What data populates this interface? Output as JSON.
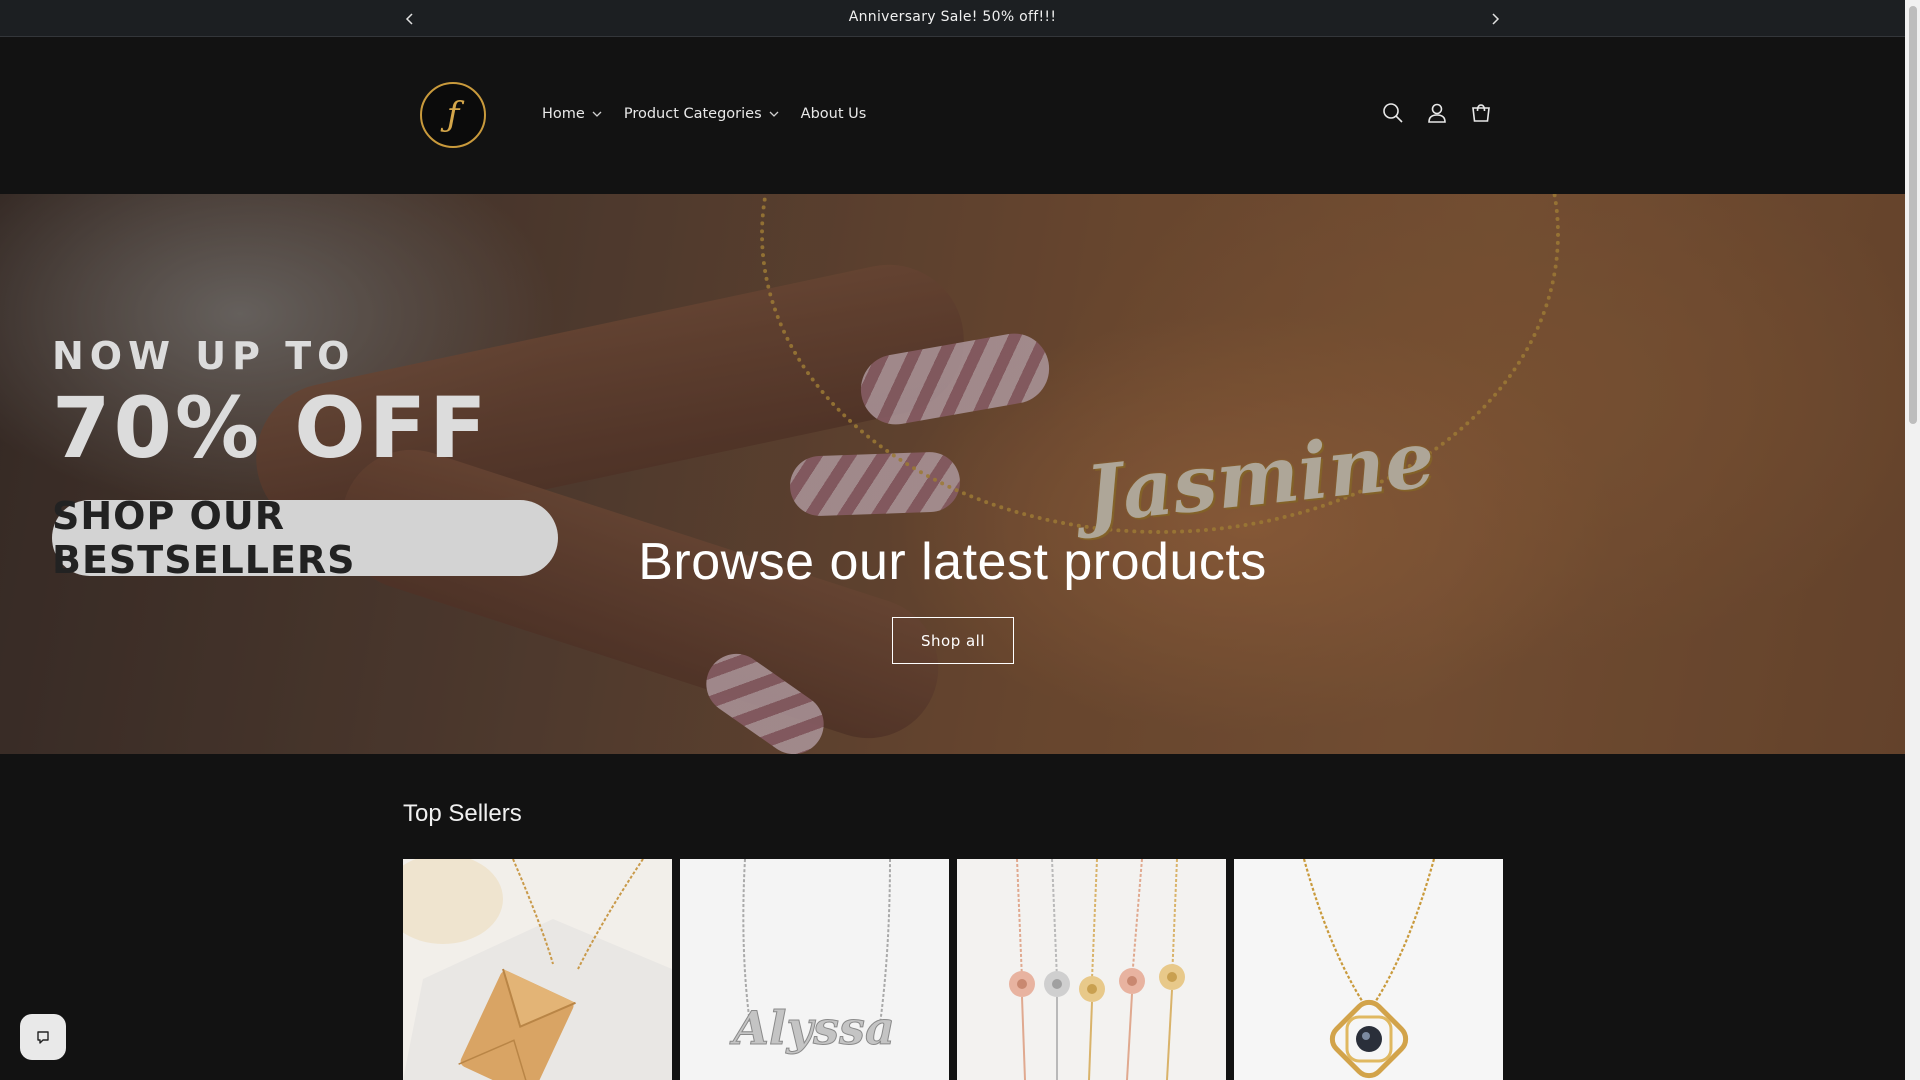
{
  "announcement": {
    "text": "Anniversary Sale! 50% off!!!",
    "prev_icon": "chevron-left-icon",
    "next_icon": "chevron-right-icon"
  },
  "header": {
    "logo_icon": "brand-logo-f-monogram",
    "nav": [
      {
        "label": "Home",
        "has_dropdown": true
      },
      {
        "label": "Product Categories",
        "has_dropdown": true
      },
      {
        "label": "About Us",
        "has_dropdown": false
      }
    ],
    "icons": [
      "search-icon",
      "account-icon",
      "cart-icon"
    ]
  },
  "hero": {
    "promo_line1": "NOW UP TO",
    "promo_line2": "70% OFF",
    "promo_button": "SHOP OUR BESTSELLERS",
    "necklace_name": "Jasmine",
    "heading": "Browse our latest products",
    "cta_label": "Shop all"
  },
  "top_sellers": {
    "title": "Top Sellers",
    "products": [
      {
        "image": "gold-envelope-locket-necklace"
      },
      {
        "image": "silver-name-necklace",
        "name_on_item": "Alyssa"
      },
      {
        "image": "birth-flower-bracelets"
      },
      {
        "image": "gold-projection-pendant-necklace"
      }
    ]
  },
  "colors": {
    "background": "#121212",
    "announcement_bg": "#1c1f22",
    "gold_accent": "#d4a64a"
  },
  "chat": {
    "icon": "chat-bubble-icon"
  }
}
